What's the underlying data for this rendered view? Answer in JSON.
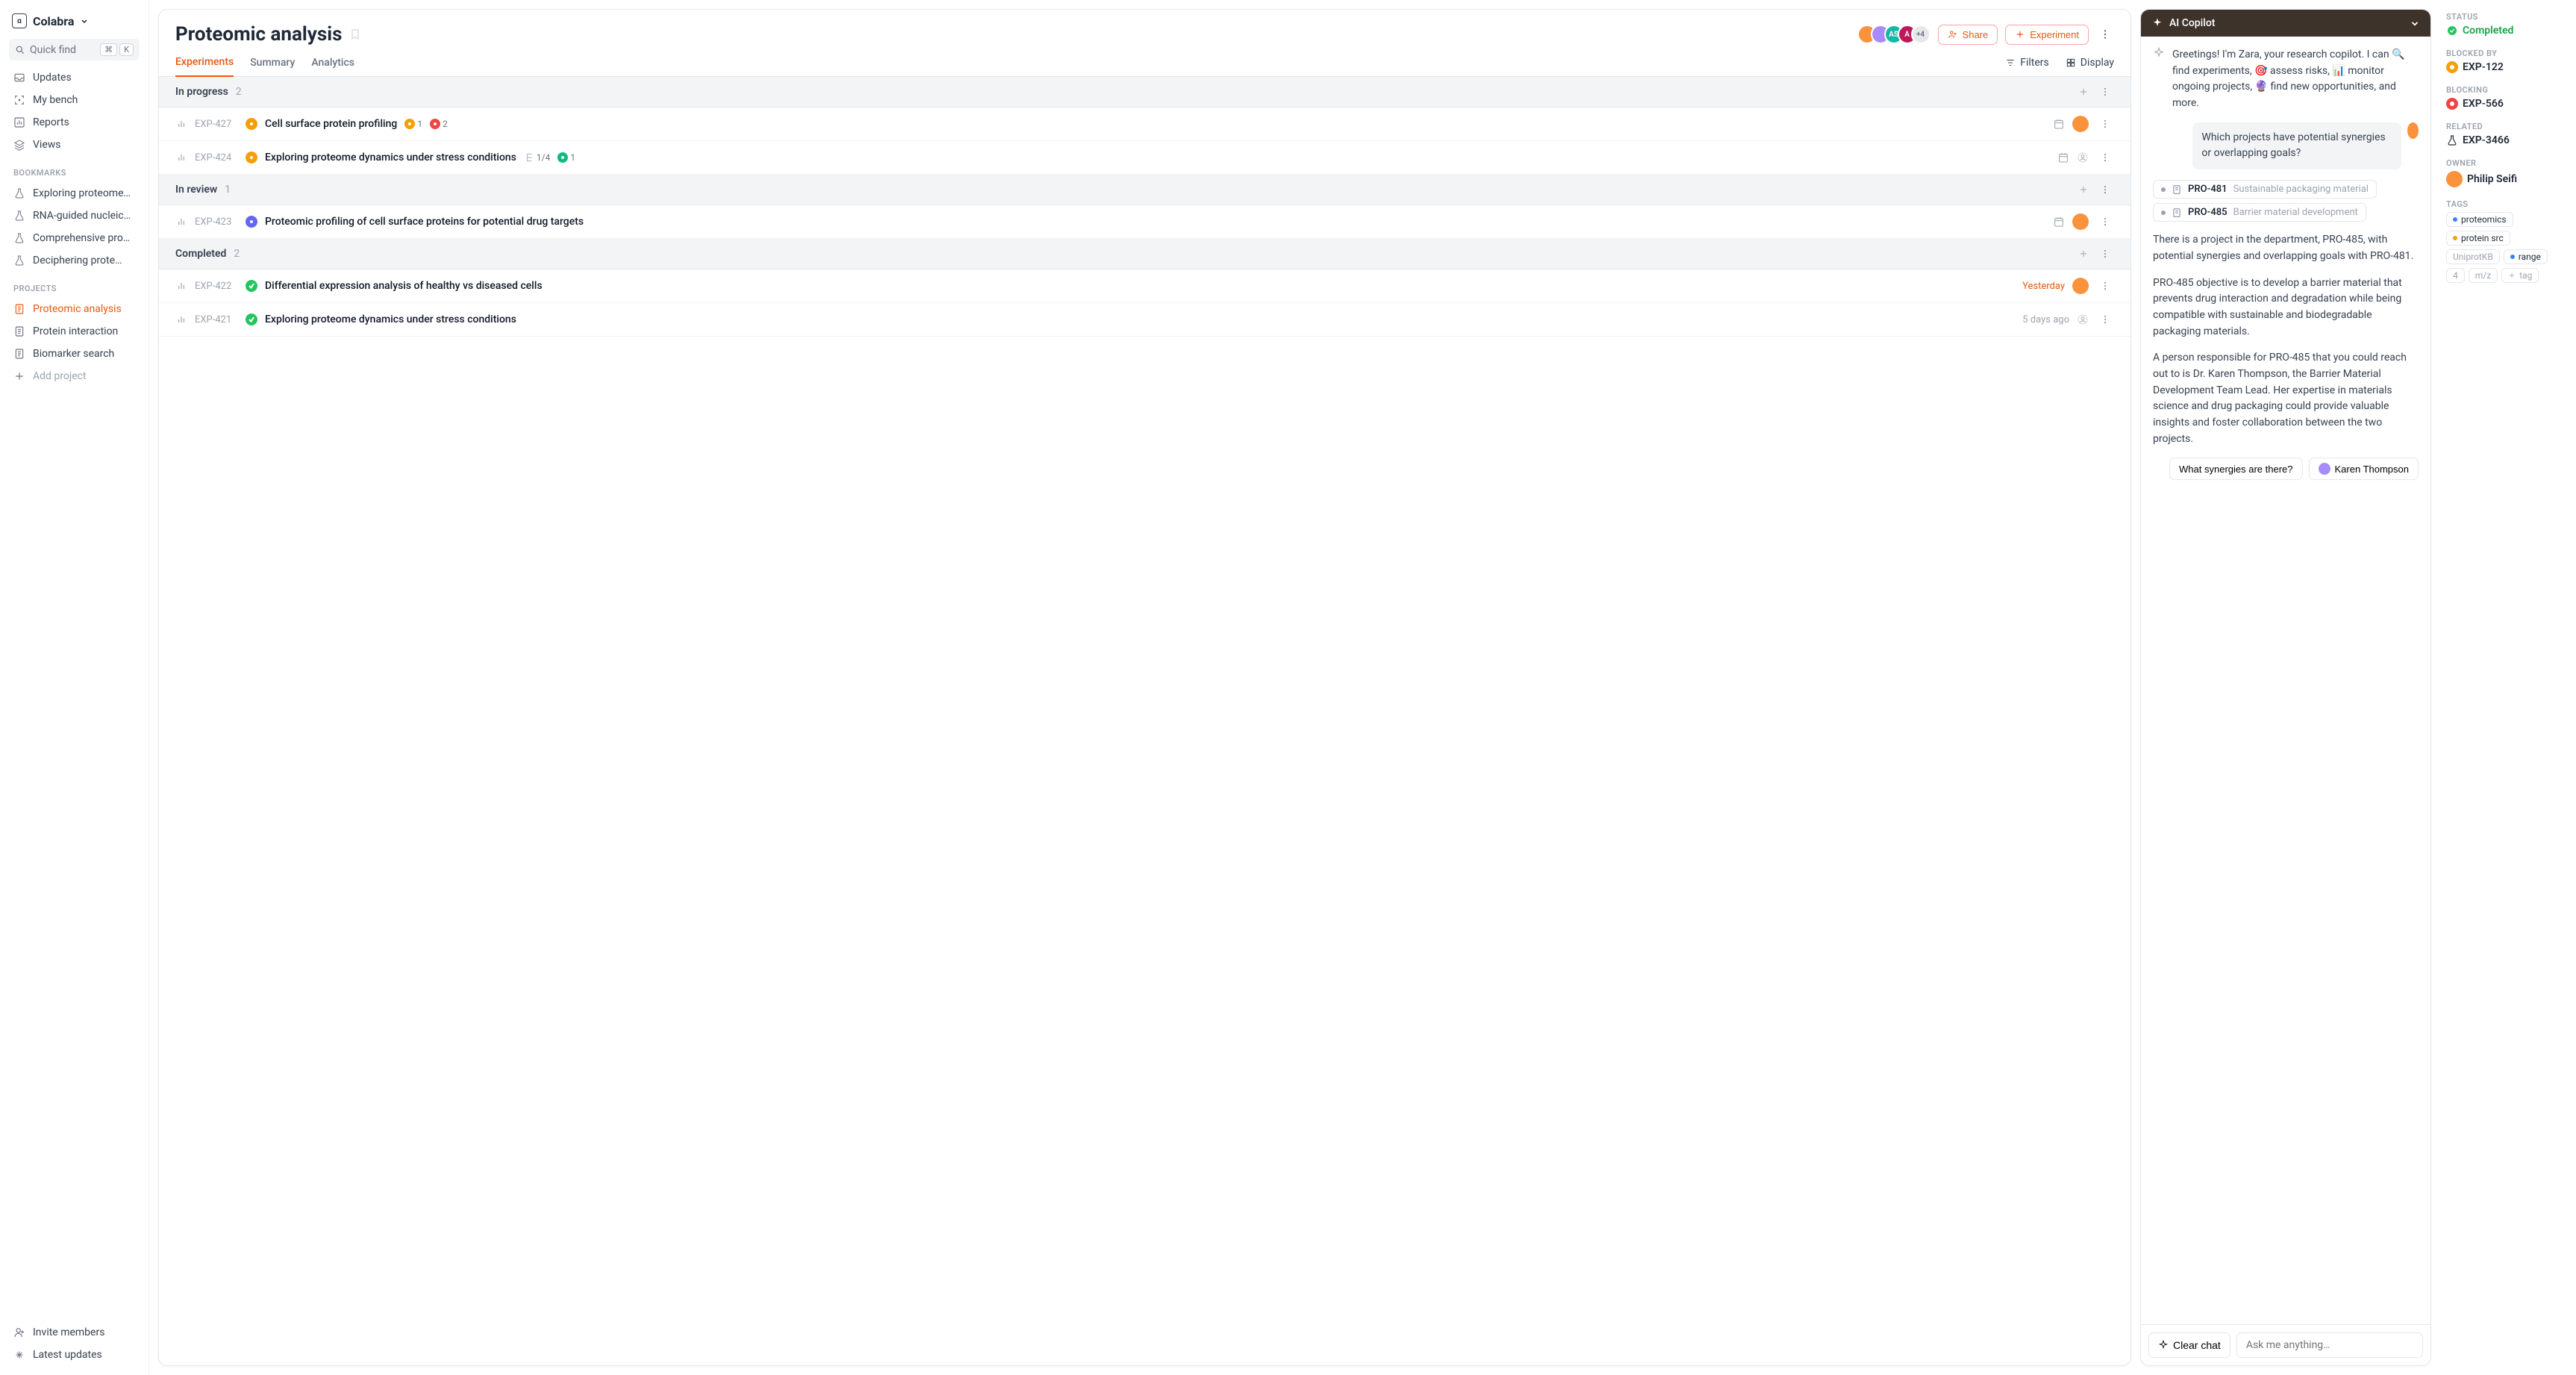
{
  "brand": "Colabra",
  "quickfind": {
    "label": "Quick find",
    "kbd1": "⌘",
    "kbd2": "K"
  },
  "nav": {
    "updates": "Updates",
    "mybench": "My bench",
    "reports": "Reports",
    "views": "Views"
  },
  "bookmarks_label": "BOOKMARKS",
  "bookmarks": [
    "Exploring proteome…",
    "RNA-guided nucleic…",
    "Comprehensive pro…",
    "Deciphering prote…"
  ],
  "projects_label": "PROJECTS",
  "projects": [
    "Proteomic analysis",
    "Protein interaction",
    "Biomarker search"
  ],
  "add_project": "Add project",
  "invite": "Invite members",
  "latest": "Latest updates",
  "page_title": "Proteomic analysis",
  "avatars": {
    "extra": "+4"
  },
  "share": "Share",
  "experiment_btn": "Experiment",
  "tabs": {
    "experiments": "Experiments",
    "summary": "Summary",
    "analytics": "Analytics"
  },
  "filters": "Filters",
  "display": "Display",
  "groups": [
    {
      "name": "In progress",
      "count": "2",
      "rows": [
        {
          "id": "EXP-427",
          "status_color": "#f59e0b",
          "title": "Cell surface protein profiling",
          "badges": [
            {
              "color": "#f59e0b",
              "text": "1"
            },
            {
              "color": "#ef4444",
              "text": "2"
            }
          ],
          "has_date_icon": true,
          "avatar": true
        },
        {
          "id": "EXP-424",
          "status_color": "#f59e0b",
          "title": "Exploring proteome dynamics under stress conditions",
          "subtask": "1/4",
          "badges": [
            {
              "color": "#10b981",
              "text": "1"
            }
          ],
          "has_date_icon": true,
          "avatar_empty": true
        }
      ]
    },
    {
      "name": "In review",
      "count": "1",
      "rows": [
        {
          "id": "EXP-423",
          "status_color": "#6366f1",
          "title": "Proteomic profiling of cell surface proteins for potential drug targets",
          "has_date_icon": true,
          "avatar": true
        }
      ]
    },
    {
      "name": "Completed",
      "count": "2",
      "rows": [
        {
          "id": "EXP-422",
          "status_color": "#22c55e",
          "check": true,
          "title": "Differential expression analysis of healthy vs diseased cells",
          "date": "Yesterday",
          "date_red": true,
          "avatar": true
        },
        {
          "id": "EXP-421",
          "status_color": "#22c55e",
          "check": true,
          "title": "Exploring proteome dynamics under stress conditions",
          "date": "5 days ago",
          "avatar_empty": true
        }
      ]
    }
  ],
  "copilot": {
    "title": "AI Copilot",
    "greeting": "Greetings! I'm Zara, your research copilot. I can 🔍 find experiments, 🎯 assess risks, 📊 monitor ongoing projects, 🔮 find new opportunities, and more.",
    "user_q": "Which projects have potential synergies or overlapping goals?",
    "projects": [
      {
        "id": "PRO-481",
        "name": "Sustainable packaging material"
      },
      {
        "id": "PRO-485",
        "name": "Barrier material development"
      }
    ],
    "p1": "There is a project in the department, PRO-485, with potential synergies and overlapping goals with PRO-481.",
    "p2": "PRO-485 objective is to develop a barrier material that prevents drug interaction and degradation while being compatible with sustainable and biodegradable packaging materials.",
    "p3": "A person responsible for PRO-485 that you could reach out to is Dr. Karen Thompson, the Barrier Material Development Team Lead. Her expertise in materials science and drug packaging could provide valuable insights and foster collaboration between the two projects.",
    "suggest1": "What synergies are there?",
    "suggest2": "Karen Thompson",
    "clear": "Clear chat",
    "placeholder": "Ask me anything…"
  },
  "details": {
    "status_label": "STATUS",
    "status_value": "Completed",
    "blocked_by_label": "BLOCKED BY",
    "blocked_by": "EXP-122",
    "blocking_label": "BLOCKING",
    "blocking": "EXP-566",
    "related_label": "RELATED",
    "related": "EXP-3466",
    "owner_label": "OWNER",
    "owner": "Philip Seifi",
    "tags_label": "TAGS",
    "tags": [
      {
        "color": "#3b82f6",
        "text": "proteomics"
      },
      {
        "color": "#f59e0b",
        "text": "protein src",
        "extra": "UniprotKB"
      },
      {
        "color": "#3b82f6",
        "text": "range",
        "extra": "4",
        "extra2": "m/z"
      }
    ],
    "add_tag": "tag"
  }
}
